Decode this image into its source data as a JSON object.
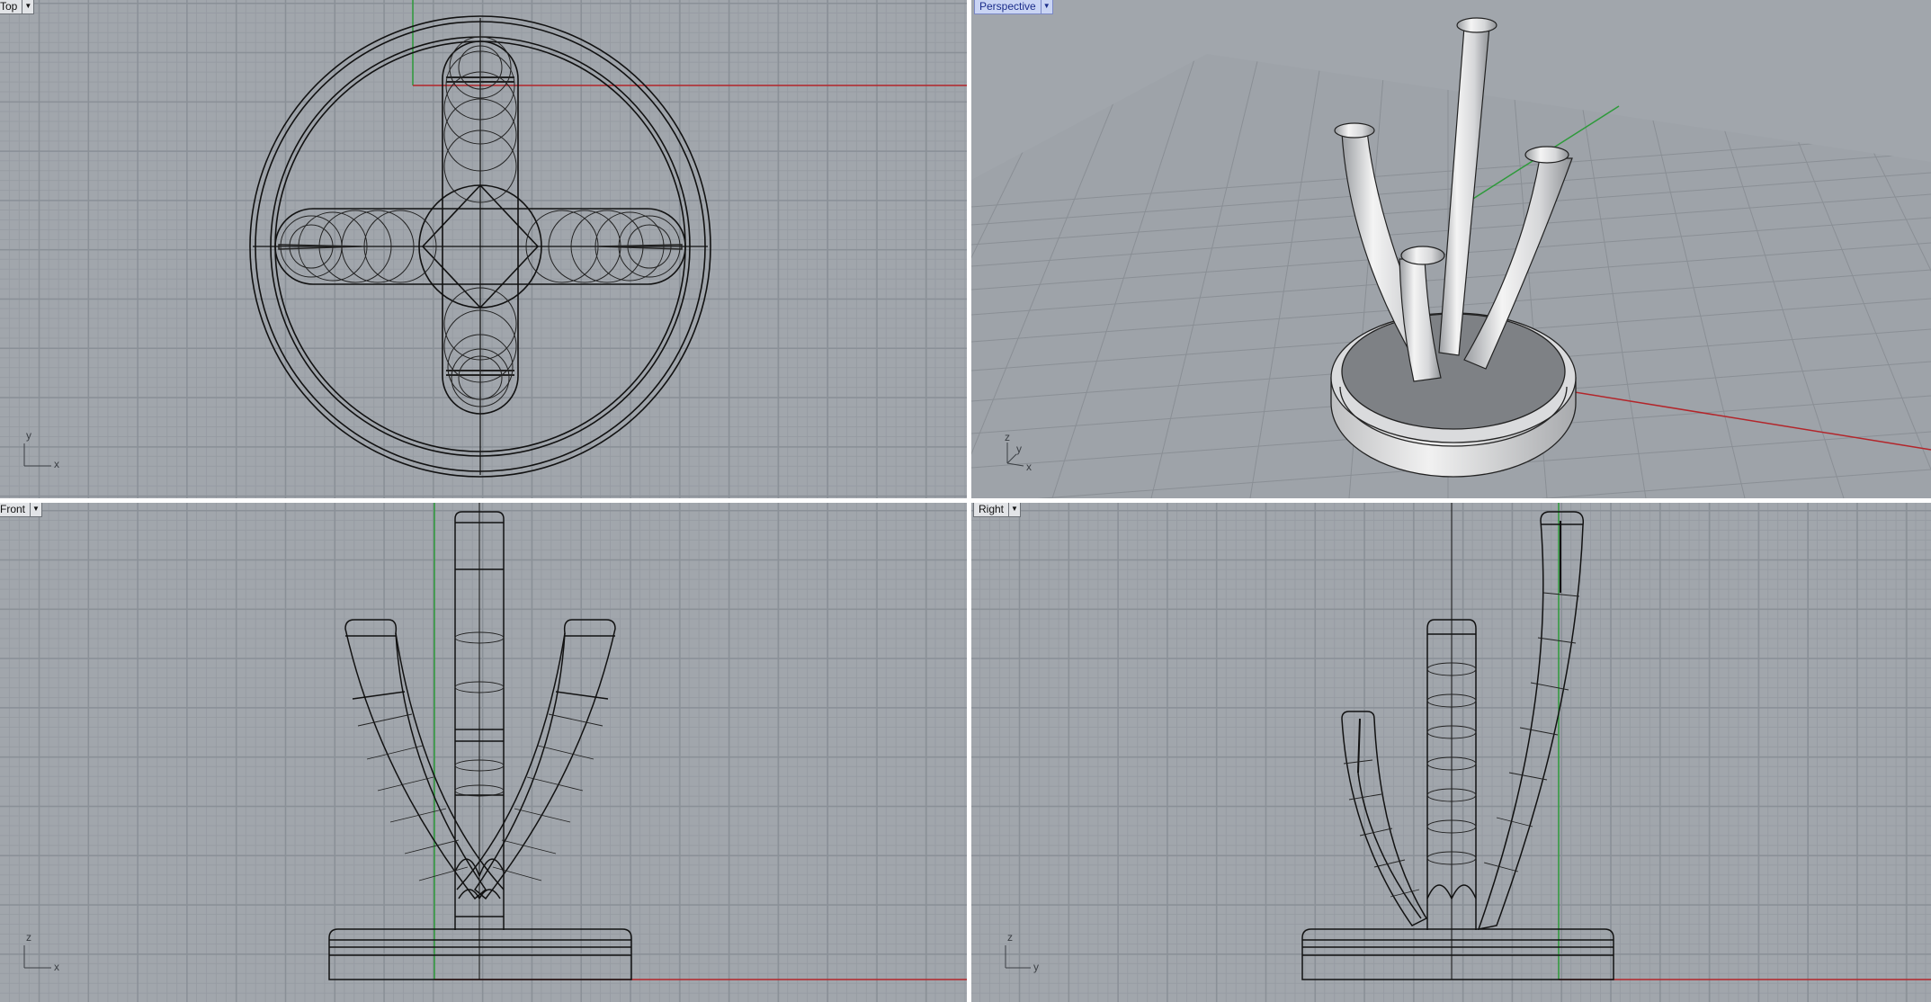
{
  "viewports": {
    "top": {
      "label": "Top",
      "axis_x": "x",
      "axis_y": "y"
    },
    "perspective": {
      "label": "Perspective",
      "axis_x": "x",
      "axis_y": "y",
      "axis_z": "z"
    },
    "front": {
      "label": "Front",
      "axis_x": "x",
      "axis_y": "z"
    },
    "right": {
      "label": "Right",
      "axis_x": "y",
      "axis_y": "z"
    }
  },
  "colors": {
    "viewport_bg": "#a1a6ac",
    "x_axis": "#b3252a",
    "y_axis": "#2d9a3a",
    "active_tab": "#c9d4f4"
  },
  "icons": {
    "viewport_menu": "chevron-down-icon"
  }
}
